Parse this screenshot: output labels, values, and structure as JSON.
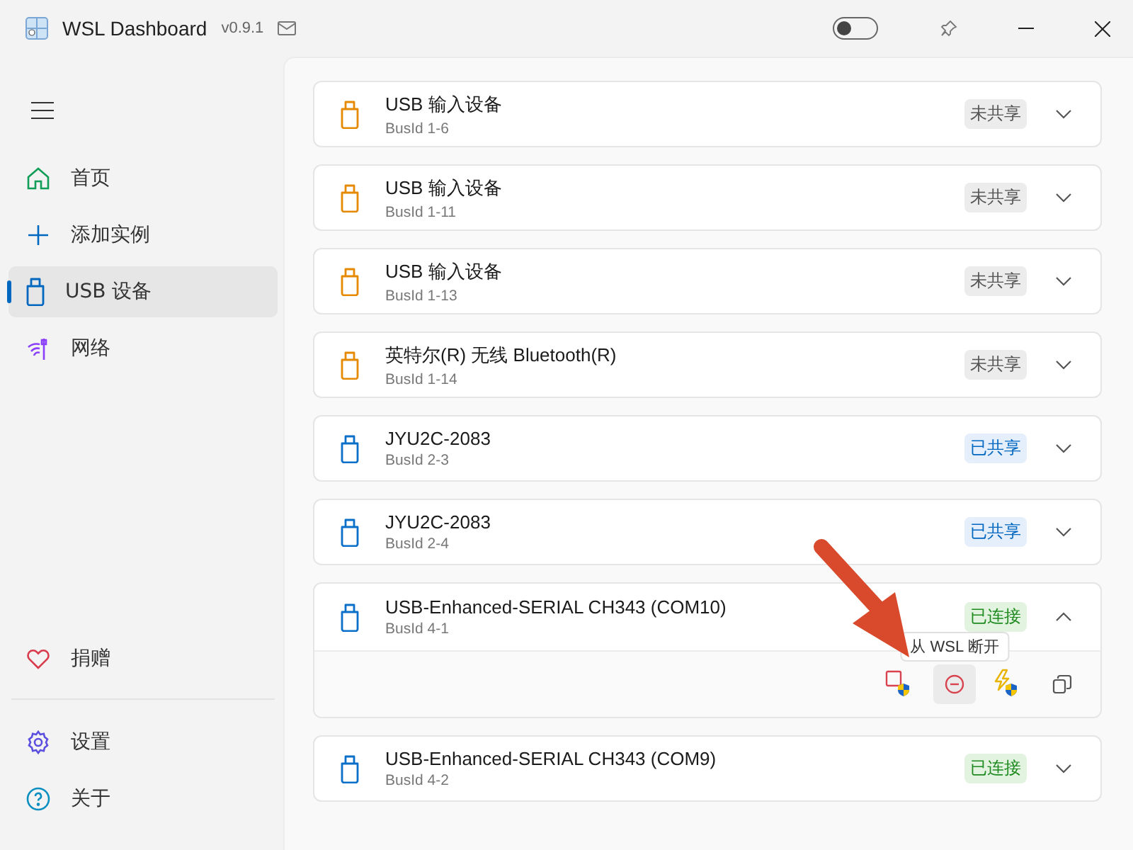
{
  "window": {
    "title": "WSL Dashboard",
    "version": "v0.9.1",
    "theme_toggle": {
      "on": false
    }
  },
  "sidebar": {
    "items": [
      {
        "label": "首页",
        "kind": "home",
        "selected": false
      },
      {
        "label": "添加实例",
        "kind": "add",
        "selected": false
      },
      {
        "label": "USB 设备",
        "kind": "usb",
        "selected": true
      },
      {
        "label": "网络",
        "kind": "network",
        "selected": false
      }
    ],
    "donate_item": {
      "label": "捐赠",
      "kind": "heart",
      "selected": false
    },
    "footer_items": [
      {
        "label": "设置",
        "kind": "settings",
        "selected": false
      },
      {
        "label": "关于",
        "kind": "help",
        "selected": false
      }
    ]
  },
  "devices": [
    {
      "name": "USB 输入设备",
      "bus_id": "BusId 1-6",
      "status": "未共享",
      "kind": "unshared",
      "expanded": false
    },
    {
      "name": "USB 输入设备",
      "bus_id": "BusId 1-11",
      "status": "未共享",
      "kind": "unshared",
      "expanded": false
    },
    {
      "name": "USB 输入设备",
      "bus_id": "BusId 1-13",
      "status": "未共享",
      "kind": "unshared",
      "expanded": false
    },
    {
      "name": "英特尔(R) 无线 Bluetooth(R)",
      "bus_id": "BusId 1-14",
      "status": "未共享",
      "kind": "unshared",
      "expanded": false
    },
    {
      "name": "JYU2C-2083",
      "bus_id": "BusId 2-3",
      "status": "已共享",
      "kind": "shared",
      "expanded": false
    },
    {
      "name": "JYU2C-2083",
      "bus_id": "BusId 2-4",
      "status": "已共享",
      "kind": "shared",
      "expanded": false
    },
    {
      "name": "USB-Enhanced-SERIAL CH343 (COM10)",
      "bus_id": "BusId 4-1",
      "status": "已连接",
      "kind": "connected",
      "expanded": true,
      "actions": [
        {
          "kind": "stop",
          "hovered": false
        },
        {
          "kind": "detach",
          "hovered": true,
          "tooltip": "从 WSL 断开"
        },
        {
          "kind": "bolt",
          "hovered": false
        },
        {
          "kind": "copy",
          "hovered": false
        }
      ]
    },
    {
      "name": "USB-Enhanced-SERIAL CH343 (COM9)",
      "bus_id": "BusId 4-2",
      "status": "已连接",
      "kind": "connected",
      "expanded": false
    }
  ]
}
